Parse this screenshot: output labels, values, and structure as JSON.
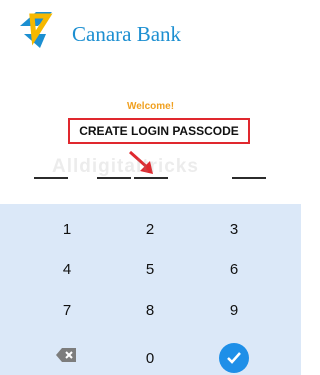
{
  "brand": {
    "name": "Canara Bank",
    "logo_icon": "canara-logo-icon"
  },
  "screen": {
    "welcome": "Welcome!",
    "heading": "CREATE LOGIN PASSCODE",
    "passcode_slots": 4,
    "watermark": "Alldigitaltricks"
  },
  "keypad": {
    "rows": [
      [
        "1",
        "2",
        "3"
      ],
      [
        "4",
        "5",
        "6"
      ],
      [
        "7",
        "8",
        "9"
      ]
    ],
    "zero": "0",
    "backspace_icon": "backspace-icon",
    "submit_icon": "checkmark-icon"
  },
  "colors": {
    "brand_blue": "#1c8fd1",
    "brand_yellow": "#f5b800",
    "welcome": "#f0a020",
    "highlight": "#e0282e",
    "keypad_bg": "#dbe8f8",
    "submit": "#1e8fe8"
  }
}
